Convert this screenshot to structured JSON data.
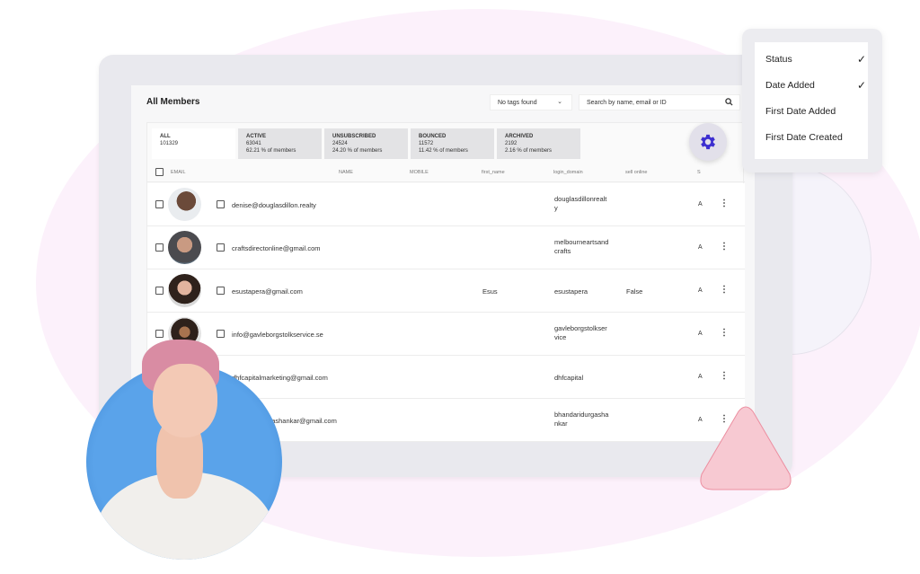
{
  "page": {
    "title": "All Members"
  },
  "toolbar": {
    "tags_select": "No tags found",
    "search_placeholder": "Search by name, email or ID"
  },
  "tabs": [
    {
      "label": "ALL",
      "count": "101329",
      "percent": ""
    },
    {
      "label": "ACTIVE",
      "count": "63041",
      "percent": "62.21 % of members"
    },
    {
      "label": "UNSUBSCRIBED",
      "count": "24524",
      "percent": "24.20 % of members"
    },
    {
      "label": "BOUNCED",
      "count": "11572",
      "percent": "11.42 % of members"
    },
    {
      "label": "ARCHIVED",
      "count": "2192",
      "percent": "2.16 % of members"
    }
  ],
  "columns": [
    "EMAIL",
    "NAME",
    "MOBILE",
    "first_name",
    "login_domain",
    "sell online",
    "S"
  ],
  "rows": [
    {
      "email": "denise@douglasdillon.realty",
      "first_name": "",
      "login_domain_l1": "douglasdillonrealt",
      "login_domain_l2": "y",
      "sell_online": "",
      "s": "A",
      "avatar_color": "#6b4a3a"
    },
    {
      "email": "craftsdirectonline@gmail.com",
      "first_name": "",
      "login_domain_l1": "melbourneartsand",
      "login_domain_l2": "crafts",
      "sell_online": "",
      "s": "A",
      "avatar_color": "#8a6a58"
    },
    {
      "email": "esustapera@gmail.com",
      "first_name": "Esus",
      "login_domain_l1": "esustapera",
      "login_domain_l2": "",
      "sell_online": "False",
      "s": "A",
      "avatar_color": "#3c2a24"
    },
    {
      "email": "info@gavleborgstolkservice.se",
      "first_name": "",
      "login_domain_l1": "gavleborgstolkser",
      "login_domain_l2": "vice",
      "sell_online": "",
      "s": "A",
      "avatar_color": "#2e211b"
    },
    {
      "email": "dhfcapitalmarketing@gmail.com",
      "first_name": "",
      "login_domain_l1": "dhfcapital",
      "login_domain_l2": "",
      "sell_online": "",
      "s": "A",
      "avatar_color": "#cccccc"
    },
    {
      "email": "bhandaridurgashankar@gmail.com",
      "first_name": "",
      "login_domain_l1": "bhandaridurgasha",
      "login_domain_l2": "nkar",
      "sell_online": "",
      "s": "A",
      "avatar_color": "#cccccc"
    }
  ],
  "column_menu": {
    "items": [
      {
        "label": "Status",
        "checked": true,
        "check": "✓"
      },
      {
        "label": "Date Added",
        "checked": true,
        "check": "✓"
      },
      {
        "label": "First Date Added",
        "checked": false,
        "check": ""
      },
      {
        "label": "First Date Created",
        "checked": false,
        "check": ""
      }
    ]
  },
  "colors": {
    "accent": "#3d2fd0",
    "background_blob": "#fcf1fb",
    "hero_bg": "#5aa3ea",
    "triangle": "#f7c9d2"
  }
}
